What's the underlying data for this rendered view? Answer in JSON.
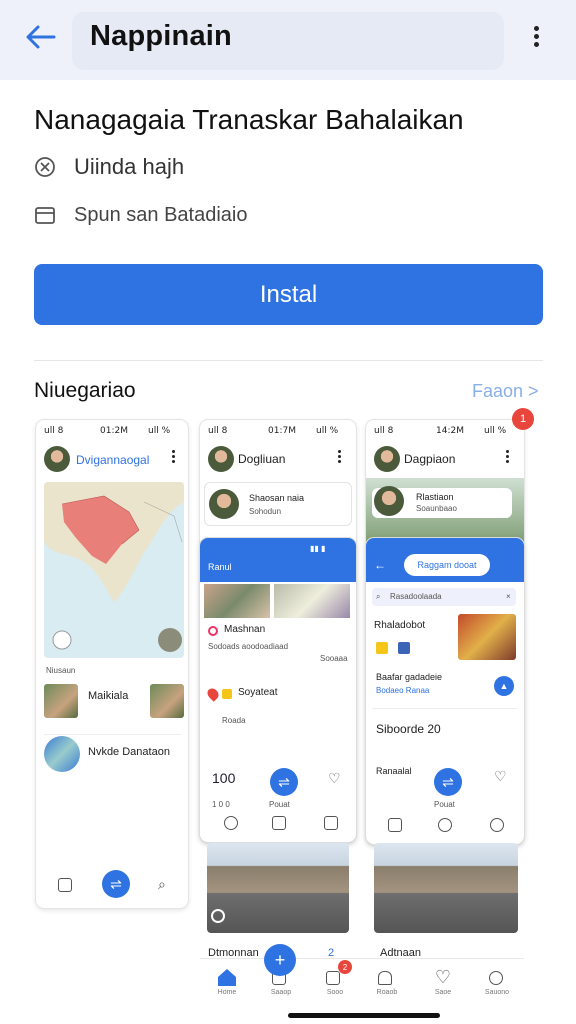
{
  "header": {
    "title": "Nappinain"
  },
  "app": {
    "name": "Nanagagaia Tranaskar Bahalaikan",
    "developer": "Uiinda hajh",
    "info": "Spun san Batadiaio",
    "install_label": "Instal"
  },
  "screenshots_section": {
    "title": "Niuegariao",
    "more_link": "Faaon >",
    "badge": "1"
  },
  "shot1": {
    "status": {
      "signal": "ull 8",
      "time": "01:2M",
      "battery": "ull %"
    },
    "header": "Dvigannaogal",
    "row1": "Maikiala",
    "row2": "Nvkde Danataon",
    "tiny": "Niusaun"
  },
  "shot2": {
    "status": {
      "signal": "ull 8",
      "time": "01:7M",
      "battery": "ull %"
    },
    "header": "Dogliuan",
    "card_title": "Shaosan naia",
    "card_sub": "Sohodun",
    "panel_title": "Ranul",
    "section_title": "Mashnan",
    "section_desc": "Sodoads aoodoadiaad",
    "section_desc2": "Sooaaa",
    "place": "Soyateat",
    "place_sub": "Roada",
    "count": "100",
    "count_sub": "1 0 0",
    "fab_label": "Pouat"
  },
  "shot3": {
    "status": {
      "signal": "ull 8",
      "time": "14:2M",
      "battery": "ull %"
    },
    "header": "Dagpiaon",
    "card_title": "Rlastiaon",
    "card_sub": "Soaunbaao",
    "pill": "Raggam dooat",
    "search": "Rasadoolaada",
    "item_title": "Rhaladobot",
    "item_sub": "Baafar gadadeie",
    "item_sub2": "Bodaeo Ranaa",
    "count": "Siboorde 20",
    "row_title": "Ranaalal",
    "fab_label": "Pouat"
  },
  "shot4": {
    "caption": "Dtmonnan",
    "caption_right": "Adtnaan",
    "counter": "2"
  },
  "bottom_nav": {
    "items": [
      "Home",
      "Saaop",
      "Sooo",
      "Roaob",
      "Saoe",
      "Sauono"
    ],
    "badge": "2"
  },
  "colors": {
    "accent": "#2f73e3",
    "topbar": "#eef1f9",
    "badge": "#e8453c"
  }
}
